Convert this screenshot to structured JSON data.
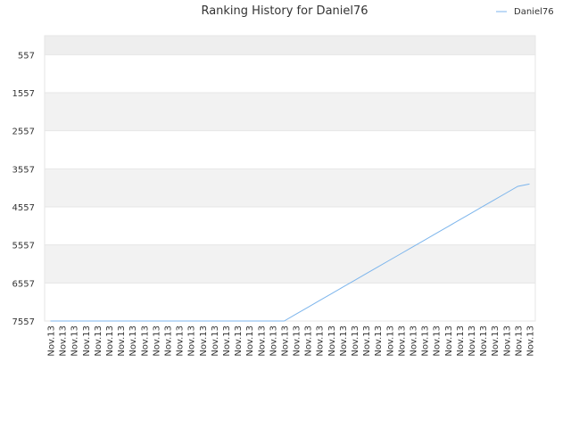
{
  "chart_data": {
    "type": "line",
    "title": "Ranking History for Daniel76",
    "xlabel": "",
    "ylabel": "",
    "y_inverted": true,
    "ylim": [
      7557,
      57
    ],
    "yticks": [
      "557",
      "1557",
      "2557",
      "3557",
      "4557",
      "5557",
      "6557",
      "7557"
    ],
    "categories": [
      "Nov.13",
      "Nov.13",
      "Nov.13",
      "Nov.13",
      "Nov.13",
      "Nov.13",
      "Nov.13",
      "Nov.13",
      "Nov.13",
      "Nov.13",
      "Nov.13",
      "Nov.13",
      "Nov.13",
      "Nov.13",
      "Nov.13",
      "Nov.13",
      "Nov.13",
      "Nov.13",
      "Nov.13",
      "Nov.13",
      "Nov.13",
      "Nov.13",
      "Nov.13",
      "Nov.13",
      "Nov.13",
      "Nov.13",
      "Nov.13",
      "Nov.13",
      "Nov.13",
      "Nov.13",
      "Nov.13",
      "Nov.13",
      "Nov.13",
      "Nov.13",
      "Nov.13",
      "Nov.13",
      "Nov.13",
      "Nov.13",
      "Nov.13",
      "Nov.13",
      "Nov.13",
      "Nov.13"
    ],
    "series": [
      {
        "name": "Daniel76",
        "color": "#7cb5ec",
        "values": [
          7557,
          7557,
          7557,
          7557,
          7557,
          7557,
          7557,
          7557,
          7557,
          7557,
          7557,
          7557,
          7557,
          7557,
          7557,
          7557,
          7557,
          7557,
          7557,
          7557,
          7557,
          7380,
          7203,
          7026,
          6849,
          6672,
          6495,
          6318,
          6141,
          5964,
          5787,
          5610,
          5433,
          5256,
          5079,
          4902,
          4725,
          4548,
          4371,
          4194,
          4017,
          3957
        ]
      }
    ],
    "grid": true,
    "legend_position": "top-right",
    "band_colors": [
      "#eeeeee",
      "#ffffff",
      "#f2f2f2"
    ],
    "grid_color": "#e6e6e6"
  }
}
